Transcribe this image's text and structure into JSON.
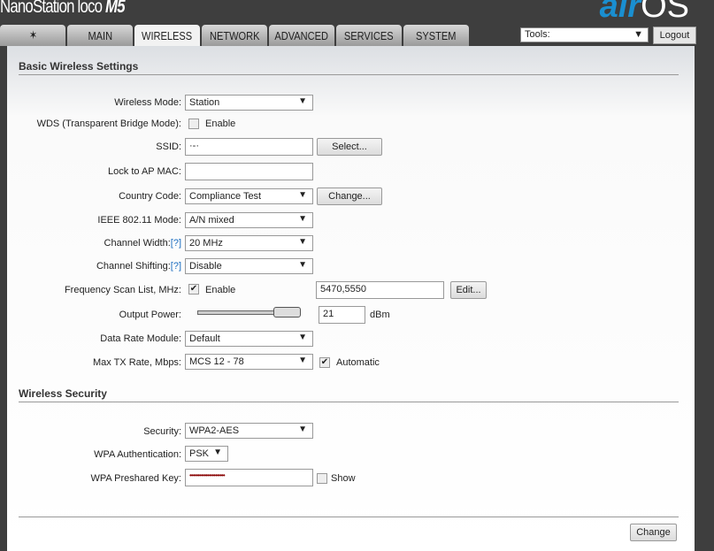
{
  "header": {
    "product": "NanoStation",
    "product_suffix": "loco",
    "model": "M5",
    "brand_prefix": "air",
    "brand_suffix": "OS"
  },
  "tabs": [
    {
      "label": "logo"
    },
    {
      "label": "MAIN"
    },
    {
      "label": "WIRELESS"
    },
    {
      "label": "NETWORK"
    },
    {
      "label": "ADVANCED"
    },
    {
      "label": "SERVICES"
    },
    {
      "label": "SYSTEM"
    }
  ],
  "tools": {
    "value": "Tools:",
    "logout": "Logout"
  },
  "basic": {
    "title": "Basic Wireless Settings",
    "wireless_mode": {
      "label": "Wireless Mode:",
      "value": "Station"
    },
    "wds": {
      "label": "WDS (Transparent Bridge Mode):",
      "option": "Enable",
      "checked": false
    },
    "ssid": {
      "label": "SSID:",
      "value": "·-·",
      "button": "Select..."
    },
    "lock_ap": {
      "label": "Lock to AP MAC:",
      "value": ""
    },
    "country": {
      "label": "Country Code:",
      "value": "Compliance Test",
      "button": "Change..."
    },
    "ieee": {
      "label": "IEEE 802.11 Mode:",
      "value": "A/N mixed"
    },
    "channel_width": {
      "label": "Channel Width:",
      "help": "[?]",
      "value": "20 MHz"
    },
    "channel_shifting": {
      "label": "Channel Shifting:",
      "help": "[?]",
      "value": "Disable"
    },
    "freq_scan": {
      "label": "Frequency Scan List, MHz:",
      "option": "Enable",
      "checked": true,
      "value": "5470,5550",
      "button": "Edit..."
    },
    "output_power": {
      "label": "Output Power:",
      "value": "21",
      "unit": "dBm",
      "slider_fraction": 1.0
    },
    "data_rate": {
      "label": "Data Rate Module:",
      "value": "Default"
    },
    "max_tx": {
      "label": "Max TX Rate, Mbps:",
      "value": "MCS 12 - 78",
      "option": "Automatic",
      "checked": true
    }
  },
  "security": {
    "title": "Wireless Security",
    "security": {
      "label": "Security:",
      "value": "WPA2-AES"
    },
    "wpa_auth": {
      "label": "WPA Authentication:",
      "value": "PSK"
    },
    "psk": {
      "label": "WPA Preshared Key:",
      "value": "••••••••••••••••••••••",
      "option": "Show",
      "checked": false
    }
  },
  "footer": {
    "change": "Change"
  }
}
